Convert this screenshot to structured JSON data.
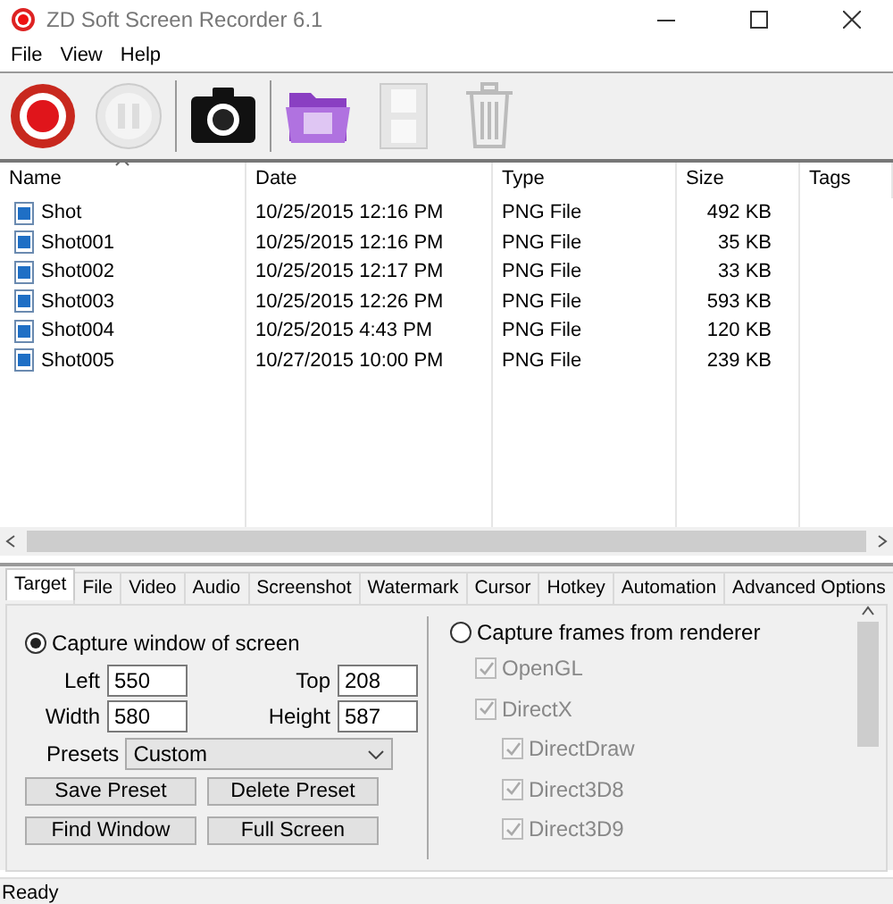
{
  "window": {
    "title": "ZD Soft Screen Recorder 6.1"
  },
  "menu": [
    "File",
    "View",
    "Help"
  ],
  "toolbar": [
    {
      "kind": "record",
      "disabled": false
    },
    {
      "kind": "pause",
      "disabled": true
    },
    {
      "kind": "separator"
    },
    {
      "kind": "camera",
      "disabled": false
    },
    {
      "kind": "separator"
    },
    {
      "kind": "folder",
      "disabled": false
    },
    {
      "kind": "film",
      "disabled": true
    },
    {
      "kind": "trash",
      "disabled": true
    }
  ],
  "file_list": {
    "columns": [
      {
        "label": "Name",
        "sorted": true
      },
      {
        "label": "Date",
        "sorted": false
      },
      {
        "label": "Type",
        "sorted": false
      },
      {
        "label": "Size",
        "sorted": false
      },
      {
        "label": "Tags",
        "sorted": false
      }
    ],
    "rows": [
      {
        "name": "Shot",
        "date": "10/25/2015 12:16 PM",
        "type": "PNG File",
        "size": "492 KB"
      },
      {
        "name": "Shot001",
        "date": "10/25/2015 12:16 PM",
        "type": "PNG File",
        "size": "35 KB"
      },
      {
        "name": "Shot002",
        "date": "10/25/2015 12:17 PM",
        "type": "PNG File",
        "size": "33 KB"
      },
      {
        "name": "Shot003",
        "date": "10/25/2015 12:26 PM",
        "type": "PNG File",
        "size": "593 KB"
      },
      {
        "name": "Shot004",
        "date": "10/25/2015 4:43 PM",
        "type": "PNG File",
        "size": "120 KB"
      },
      {
        "name": "Shot005",
        "date": "10/27/2015 10:00 PM",
        "type": "PNG File",
        "size": "239 KB"
      }
    ]
  },
  "tabs": [
    {
      "label": "Target",
      "selected": true
    },
    {
      "label": "File",
      "selected": false
    },
    {
      "label": "Video",
      "selected": false
    },
    {
      "label": "Audio",
      "selected": false
    },
    {
      "label": "Screenshot",
      "selected": false
    },
    {
      "label": "Watermark",
      "selected": false
    },
    {
      "label": "Cursor",
      "selected": false
    },
    {
      "label": "Hotkey",
      "selected": false
    },
    {
      "label": "Automation",
      "selected": false
    },
    {
      "label": "Advanced Options",
      "selected": false
    }
  ],
  "target": {
    "capture_window": {
      "label": "Capture window of screen",
      "selected": true
    },
    "fields": [
      {
        "label": "Left",
        "value": "550"
      },
      {
        "label": "Top",
        "value": "208"
      },
      {
        "label": "Width",
        "value": "580"
      },
      {
        "label": "Height",
        "value": "587"
      }
    ],
    "presets": {
      "label": "Presets",
      "value": "Custom"
    },
    "buttons": [
      "Save Preset",
      "Delete Preset",
      "Find Window",
      "Full Screen"
    ],
    "capture_renderer": {
      "label": "Capture frames from renderer",
      "selected": false
    },
    "renderers": [
      {
        "label": "OpenGL",
        "checked": true,
        "disabled": true
      },
      {
        "label": "DirectX",
        "checked": true,
        "disabled": true,
        "children": [
          {
            "label": "DirectDraw",
            "checked": true,
            "disabled": true
          },
          {
            "label": "Direct3D8",
            "checked": true,
            "disabled": true
          },
          {
            "label": "Direct3D9",
            "checked": true,
            "disabled": true
          }
        ]
      }
    ]
  },
  "status_bar": {
    "text": "Ready"
  }
}
